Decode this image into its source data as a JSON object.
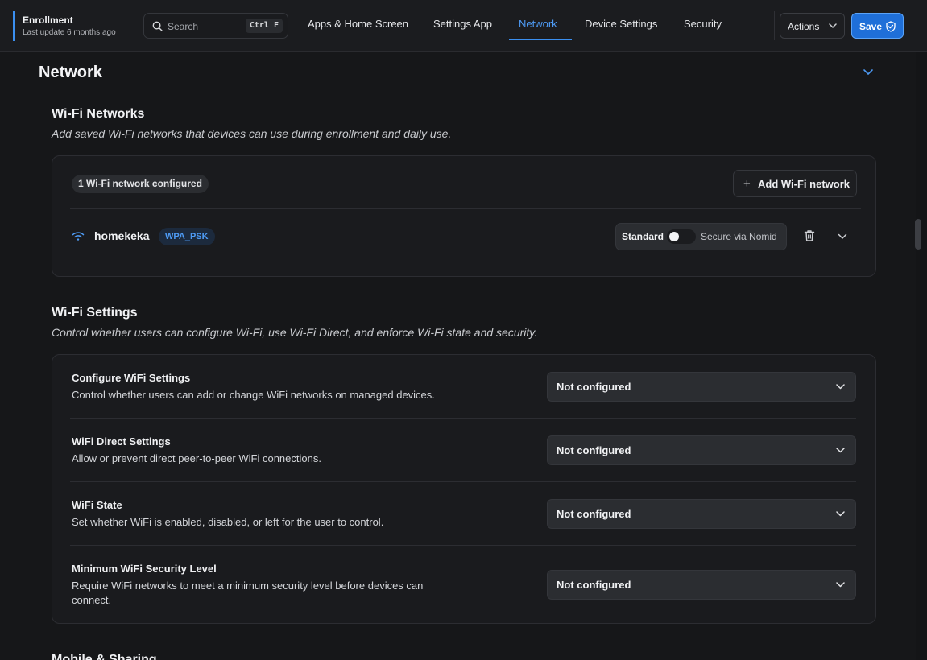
{
  "header": {
    "app_title": "Enrollment",
    "last_update": "Last update 6 months ago",
    "search_placeholder": "Search",
    "search_shortcut": "Ctrl F",
    "tabs": [
      {
        "label": "Apps & Home Screen",
        "active": false
      },
      {
        "label": "Settings App",
        "active": false
      },
      {
        "label": "Network",
        "active": true
      },
      {
        "label": "Device Settings",
        "active": false
      },
      {
        "label": "Security",
        "active": false
      }
    ],
    "actions_label": "Actions",
    "save_label": "Save"
  },
  "colors": {
    "accent": "#3b8ff0",
    "background": "#161719",
    "card": "#1a1b1e"
  },
  "section": {
    "title": "Network"
  },
  "wifi_networks": {
    "title": "Wi-Fi Networks",
    "description": "Add saved Wi-Fi networks that devices can use during enrollment and daily use.",
    "count_label": "1 Wi-Fi network configured",
    "add_label": "Add Wi-Fi network",
    "networks": [
      {
        "name": "homekeka",
        "security": "WPA_PSK",
        "mode_left": "Standard",
        "mode_right": "Secure via Nomid",
        "icon": "wifi-icon"
      }
    ]
  },
  "wifi_settings": {
    "title": "Wi-Fi Settings",
    "description": "Control whether users can configure Wi-Fi, use Wi-Fi Direct, and enforce Wi-Fi state and security.",
    "rows": [
      {
        "label": "Configure WiFi Settings",
        "help": "Control whether users can add or change WiFi networks on managed devices.",
        "value": "Not configured"
      },
      {
        "label": "WiFi Direct Settings",
        "help": "Allow or prevent direct peer-to-peer WiFi connections.",
        "value": "Not configured"
      },
      {
        "label": "WiFi State",
        "help": "Set whether WiFi is enabled, disabled, or left for the user to control.",
        "value": "Not configured"
      },
      {
        "label": "Minimum WiFi Security Level",
        "help": "Require WiFi networks to meet a minimum security level before devices can connect.",
        "value": "Not configured"
      }
    ]
  },
  "next_section": {
    "title": "Mobile & Sharing"
  }
}
